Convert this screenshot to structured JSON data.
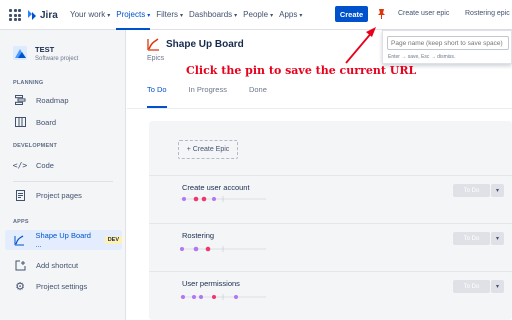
{
  "topbar": {
    "logo": "Jira",
    "nav": [
      {
        "label": "Your work",
        "active": false
      },
      {
        "label": "Projects",
        "active": true
      },
      {
        "label": "Filters",
        "active": false
      },
      {
        "label": "Dashboards",
        "active": false
      },
      {
        "label": "People",
        "active": false
      },
      {
        "label": "Apps",
        "active": false
      }
    ],
    "create_label": "Create",
    "bookmarks": [
      "Create user epic",
      "Rostering epic"
    ]
  },
  "popup": {
    "placeholder": "Page name (keep short to save space)",
    "hint": "Enter → save, Esc → dismiss."
  },
  "sidebar": {
    "project_name": "TEST",
    "project_type": "Software project",
    "sections": {
      "planning": "PLANNING",
      "development": "DEVELOPMENT",
      "apps": "APPS"
    },
    "items": {
      "roadmap": "Roadmap",
      "board": "Board",
      "code": "Code",
      "project_pages": "Project pages",
      "shape_up": "Shape Up Board ...",
      "dev_badge": "DEV",
      "add_shortcut": "Add shortcut",
      "project_settings": "Project settings"
    }
  },
  "main": {
    "title": "Shape Up Board",
    "subtitle": "Epics",
    "tabs": [
      "To Do",
      "In Progress",
      "Done"
    ],
    "active_tab": "To Do",
    "create_epic_label": "+ Create Epic",
    "epics": [
      {
        "name": "Create user account",
        "status": "To Do"
      },
      {
        "name": "Rostering",
        "status": "To Do"
      },
      {
        "name": "User permissions",
        "status": "To Do"
      }
    ]
  },
  "annotation": {
    "text": "Click the pin to save the current URL"
  },
  "colors": {
    "primary": "#0052cc",
    "annotation": "#e8001c",
    "pin": "#de350b",
    "dot_purple": "#b076f5",
    "dot_pink": "#f2356e"
  }
}
